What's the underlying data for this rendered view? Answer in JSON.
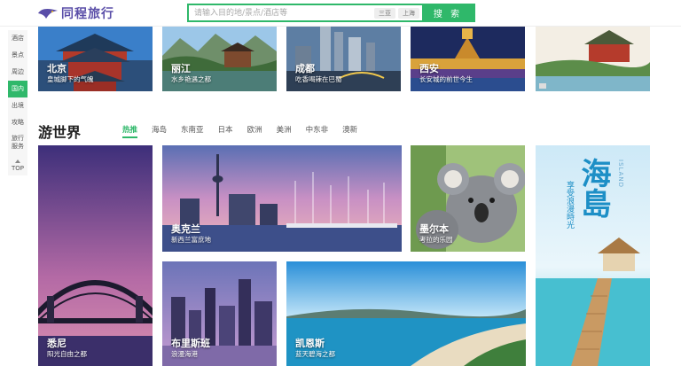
{
  "header": {
    "logo_text": "同程旅行",
    "search_placeholder": "请输入目的地/景点/酒店等",
    "chips": [
      "三亚",
      "上海"
    ],
    "search_button": "搜 索"
  },
  "sidebar": {
    "items": [
      "酒店",
      "景点",
      "周边",
      "国内",
      "出境",
      "攻略",
      "旅行服务"
    ],
    "active_index": 3,
    "top_label": "TOP"
  },
  "domestic": [
    {
      "title": "北京",
      "sub": "皇城脚下的气魄"
    },
    {
      "title": "丽江",
      "sub": "水乡艳遇之都"
    },
    {
      "title": "成都",
      "sub": "吃香喝辣在巴蜀"
    },
    {
      "title": "西安",
      "sub": "长安城的前世今生"
    }
  ],
  "world": {
    "title": "游世界",
    "tabs": [
      "热推",
      "海岛",
      "东南亚",
      "日本",
      "欧洲",
      "美洲",
      "中东非",
      "澳新"
    ],
    "active_tab": 0,
    "tiles": [
      {
        "title": "悉尼",
        "sub": "阳光自由之都"
      },
      {
        "title": "奥克兰",
        "sub": "新西兰富庶地"
      },
      {
        "title": "墨尔本",
        "sub": "考拉的乐园"
      },
      {
        "title": "布里斯班",
        "sub": "浪漫海港"
      },
      {
        "title": "凯恩斯",
        "sub": "蓝天碧海之都"
      }
    ],
    "banner": {
      "big": "海島",
      "small": "享受浪漫時光",
      "side": "ISLAND"
    }
  },
  "colors": {
    "brand": "#5a4ea8",
    "accent": "#2fb86a"
  }
}
